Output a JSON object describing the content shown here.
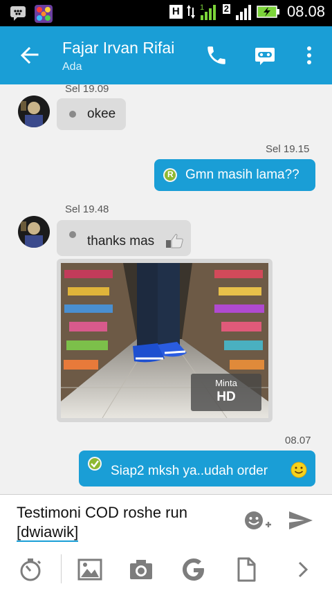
{
  "status_bar": {
    "network_type": "H",
    "sim2_label": "2",
    "time": "08.08"
  },
  "header": {
    "contact_name": "Fajar Irvan Rifai",
    "status": "Ada"
  },
  "messages": [
    {
      "time": "Sel 19.09",
      "text": "okee"
    },
    {
      "time": "Sel 19.15",
      "initial": "R",
      "text": "Gmn masih lama??"
    },
    {
      "time": "Sel 19.48",
      "text": "thanks mas"
    },
    {
      "image_overlay": {
        "line1": "Minta",
        "line2": "HD"
      }
    },
    {
      "time": "08.07",
      "text": "Siap2 mksh ya..udah order"
    }
  ],
  "composer": {
    "text": "Testimoni COD roshe run",
    "tag": "[dwiawik]"
  },
  "colors": {
    "brand": "#1a9ed6",
    "incoming_bubble": "#dcdcdc",
    "status_bar": "#000000",
    "battery": "#7cd43a"
  }
}
